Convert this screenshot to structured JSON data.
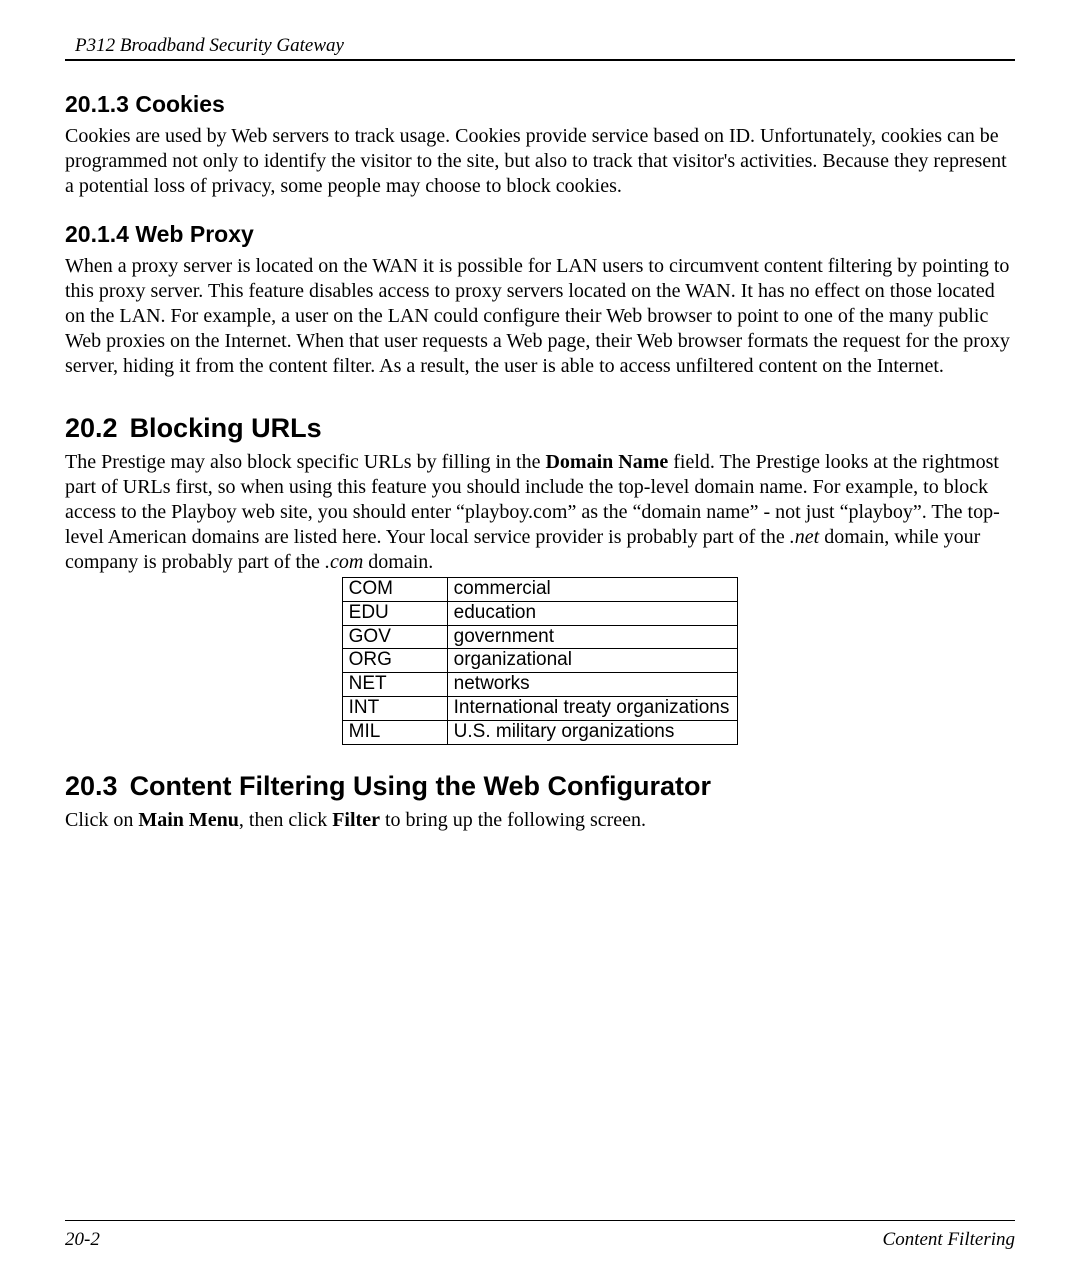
{
  "header": {
    "running_head": "P312  Broadband Security Gateway"
  },
  "sections": {
    "cookies": {
      "heading": "20.1.3 Cookies",
      "body": "Cookies are used by Web servers to track usage. Cookies provide service based on ID. Unfortunately, cookies can be programmed not only to identify the visitor to the site, but also to track that visitor's activities. Because they represent a potential loss of privacy, some people may choose to block cookies."
    },
    "webproxy": {
      "heading": "20.1.4 Web Proxy",
      "body": "When a proxy server is located on the WAN it is possible for LAN users to circumvent content filtering by pointing to this proxy server. This feature disables access to proxy servers located on the WAN. It has no effect on those located on the LAN. For example, a user on the LAN could configure their Web browser to point to one of the many public Web proxies on the Internet. When that user requests a Web page, their Web browser formats the request for the proxy server, hiding it from the content filter. As a result, the user is able to access unfiltered content on the Internet."
    },
    "blocking": {
      "number": "20.2",
      "title": "Blocking URLs",
      "body_pre": "The Prestige may also block specific URLs by filling in the ",
      "bold1": "Domain Name",
      "body_mid": " field. The Prestige looks at the rightmost part of URLs first, so when using this feature you should include the top-level domain name.  For example, to block access to the Playboy web site, you should enter  “playboy.com” as the “domain name” - not just “playboy”. The top-level American domains are listed here. Your local service provider is probably part of the ",
      "ital1": ".net",
      "body_mid2": " domain, while your company is probably part of the ",
      "ital2": ".com",
      "body_end": " domain.",
      "table": [
        {
          "code": "COM",
          "desc": "commercial"
        },
        {
          "code": "EDU",
          "desc": "education"
        },
        {
          "code": "GOV",
          "desc": "government"
        },
        {
          "code": "ORG",
          "desc": "organizational"
        },
        {
          "code": "NET",
          "desc": "networks"
        },
        {
          "code": "INT",
          "desc": "International treaty organizations"
        },
        {
          "code": "MIL",
          "desc": "U.S. military organizations"
        }
      ]
    },
    "filtering": {
      "number": "20.3",
      "title": "Content Filtering Using the Web Configurator",
      "body_pre": "Click on ",
      "bold1": "Main Menu",
      "body_mid": ", then click ",
      "bold2": "Filter",
      "body_end": " to bring up the following screen."
    }
  },
  "footer": {
    "page_number": "20-2",
    "section_label": "Content Filtering"
  }
}
